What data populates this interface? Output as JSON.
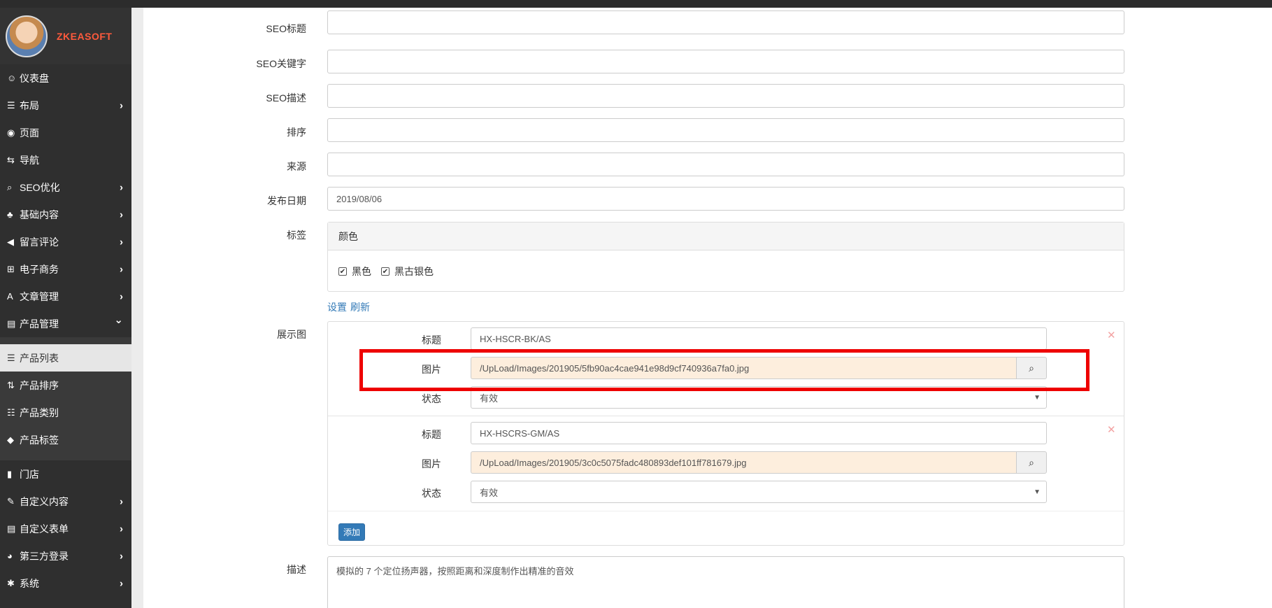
{
  "brand": {
    "name": "ZKEASOFT"
  },
  "sidebar": {
    "items": [
      {
        "label": "仪表盘",
        "icon": "dashboard-icon",
        "glyph": "☺"
      },
      {
        "label": "布局",
        "icon": "table-icon",
        "glyph": "☰",
        "chevron": "right"
      },
      {
        "label": "页面",
        "icon": "eye-icon",
        "glyph": "◉"
      },
      {
        "label": "导航",
        "icon": "retweet-icon",
        "glyph": "⇆"
      },
      {
        "label": "SEO优化",
        "icon": "search-icon",
        "glyph": "⌕",
        "chevron": "right"
      },
      {
        "label": "基础内容",
        "icon": "tree-icon",
        "glyph": "♣",
        "chevron": "right"
      },
      {
        "label": "留言评论",
        "icon": "bullhorn-icon",
        "glyph": "◀",
        "chevron": "right"
      },
      {
        "label": "电子商务",
        "icon": "cart-icon",
        "glyph": "⊞",
        "chevron": "right"
      },
      {
        "label": "文章管理",
        "icon": "font-icon",
        "glyph": "A",
        "chevron": "right"
      },
      {
        "label": "产品管理",
        "icon": "list-alt-icon",
        "glyph": "▤",
        "chevron": "down"
      }
    ],
    "sub_items": [
      {
        "label": "产品列表",
        "icon": "list-icon",
        "glyph": "☰",
        "active": true
      },
      {
        "label": "产品排序",
        "icon": "sort-icon",
        "glyph": "⇅"
      },
      {
        "label": "产品类别",
        "icon": "th-list-icon",
        "glyph": "☷"
      },
      {
        "label": "产品标签",
        "icon": "tag-icon",
        "glyph": "◆"
      }
    ],
    "bottom_items": [
      {
        "label": "门店",
        "icon": "book-icon",
        "glyph": "▮"
      },
      {
        "label": "自定义内容",
        "icon": "wrench-icon",
        "glyph": "✎",
        "chevron": "right"
      },
      {
        "label": "自定义表单",
        "icon": "form-icon",
        "glyph": "▤",
        "chevron": "right"
      },
      {
        "label": "第三方登录",
        "icon": "user-icon",
        "glyph": "◕",
        "chevron": "right"
      },
      {
        "label": "系统",
        "icon": "cog-icon",
        "glyph": "✱",
        "chevron": "right"
      }
    ]
  },
  "form": {
    "seo_title_label": "SEO标题",
    "seo_keywords_label": "SEO关键字",
    "seo_description_label": "SEO描述",
    "order_label": "排序",
    "source_label": "来源",
    "publish_date_label": "发布日期",
    "publish_date_value": "2019/08/06",
    "tags_label": "标签",
    "tag_group_title": "颜色",
    "tag_options": [
      "黑色",
      "黑古银色"
    ],
    "links": [
      "设置",
      "刷新"
    ],
    "gallery_label": "展示图",
    "gallery_items": [
      {
        "title_label": "标题",
        "title_value": "HX-HSCR-BK/AS",
        "image_label": "图片",
        "image_value": "/UpLoad/Images/201905/5fb90ac4cae941e98d9cf740936a7fa0.jpg",
        "status_label": "状态",
        "status_value": "有效"
      },
      {
        "title_label": "标题",
        "title_value": "HX-HSCRS-GM/AS",
        "image_label": "图片",
        "image_value": "/UpLoad/Images/201905/3c0c5075fadc480893def101ff781679.jpg",
        "status_label": "状态",
        "status_value": "有效"
      }
    ],
    "add_button": "添加",
    "description_label": "描述",
    "description_value": "模拟的 7 个定位扬声器，按照距离和深度制作出精准的音效"
  },
  "colors": {
    "highlight": "#ee0000",
    "brand": "#ff5a3c",
    "link": "#337ab7"
  }
}
